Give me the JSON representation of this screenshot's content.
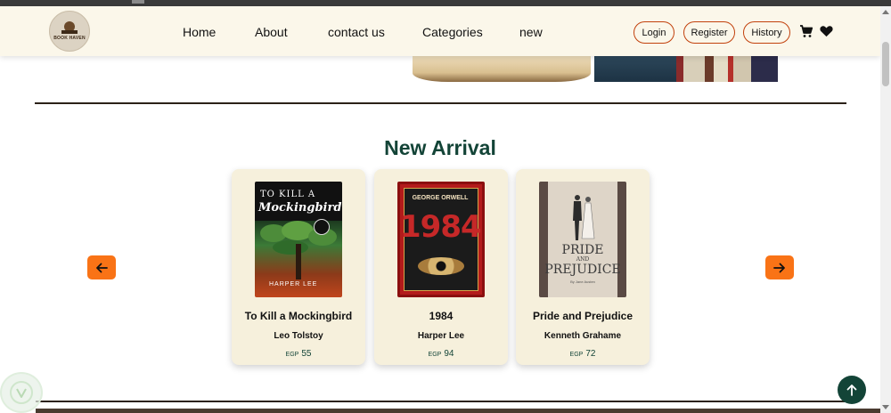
{
  "nav": {
    "logo_text": "BOOK HAVEN",
    "links": [
      "Home",
      "About",
      "contact us",
      "Categories",
      "new"
    ],
    "buttons": {
      "login": "Login",
      "register": "Register",
      "history": "History"
    }
  },
  "section": {
    "title": "New Arrival"
  },
  "books": [
    {
      "title": "To Kill a Mockingbird",
      "author": "Leo Tolstoy",
      "currency": "EGP",
      "price": "55",
      "cover": {
        "line1": "TO KILL A",
        "line2": "Mockingbird",
        "line3": "HARPER LEE"
      }
    },
    {
      "title": "1984",
      "author": "Harper Lee",
      "currency": "EGP",
      "price": "94",
      "cover": {
        "line1": "GEORGE ORWELL",
        "line2": "1984"
      }
    },
    {
      "title": "Pride and Prejudice",
      "author": "Kenneth Grahame",
      "currency": "EGP",
      "price": "72",
      "cover": {
        "line1": "PRIDE",
        "line2": "AND",
        "line3": "PREJUDICE",
        "line4": "By Jane Austen"
      }
    }
  ],
  "icons": {
    "cart": "cart-icon",
    "heart": "heart-icon",
    "prev": "arrow-left-icon",
    "next": "arrow-right-icon",
    "top": "arrow-up-icon"
  },
  "colors": {
    "accent": "#f97316",
    "primary": "#134437",
    "nav_bg": "#fbf7ea",
    "card_bg": "#f6f0dc",
    "pill_border": "#c2410c"
  }
}
